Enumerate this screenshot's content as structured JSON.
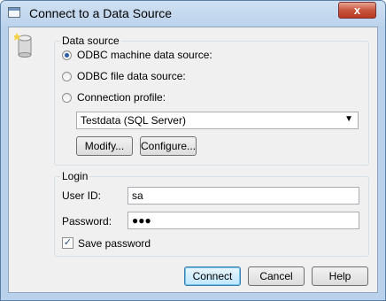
{
  "window": {
    "title": "Connect to a Data Source",
    "close_label": "x"
  },
  "data_source": {
    "label": "Data source",
    "options": [
      {
        "label": "ODBC machine data source:",
        "selected": true
      },
      {
        "label": "ODBC file data source:",
        "selected": false
      },
      {
        "label": "Connection profile:",
        "selected": false
      }
    ],
    "profile_select_value": "Testdata (SQL Server)",
    "modify_label": "Modify...",
    "configure_label": "Configure..."
  },
  "login": {
    "label": "Login",
    "user_id_label": "User ID:",
    "user_id_value": "sa",
    "password_label": "Password:",
    "password_value": "●●●",
    "save_password_label": "Save password",
    "save_password_checked": true
  },
  "buttons": {
    "connect": "Connect",
    "cancel": "Cancel",
    "help": "Help"
  }
}
